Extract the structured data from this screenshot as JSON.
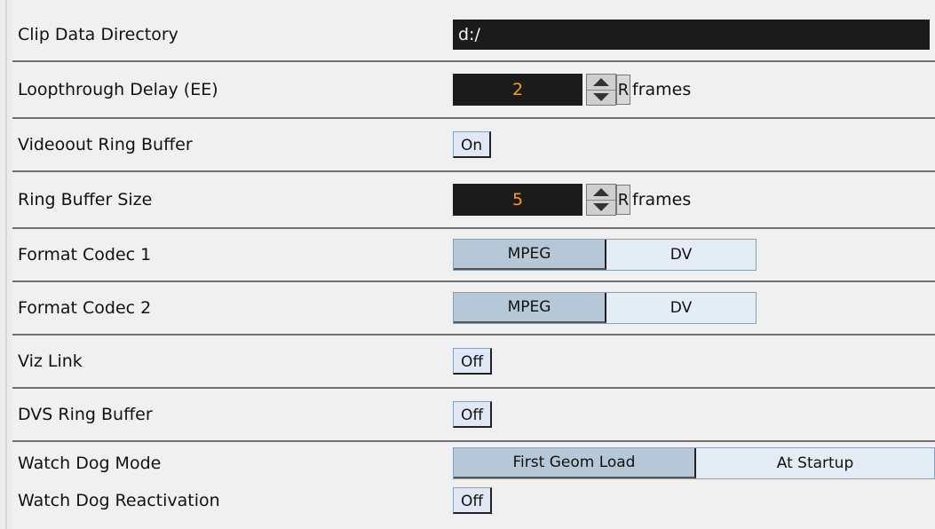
{
  "settings": {
    "clip_data_directory": {
      "label": "Clip Data Directory",
      "value": "d:/"
    },
    "loopthrough_delay": {
      "label": "Loopthrough Delay (EE)",
      "value": "2",
      "reset": "R",
      "unit": "frames"
    },
    "videoout_ring_buffer": {
      "label": "Videoout Ring Buffer",
      "value": "On"
    },
    "ring_buffer_size": {
      "label": "Ring Buffer Size",
      "value": "5",
      "reset": "R",
      "unit": "frames"
    },
    "format_codec_1": {
      "label": "Format Codec 1",
      "options": [
        "MPEG",
        "DV"
      ],
      "selected": "MPEG"
    },
    "format_codec_2": {
      "label": "Format Codec 2",
      "options": [
        "MPEG",
        "DV"
      ],
      "selected": "MPEG"
    },
    "viz_link": {
      "label": "Viz Link",
      "value": "Off"
    },
    "dvs_ring_buffer": {
      "label": "DVS Ring Buffer",
      "value": "Off"
    },
    "watch_dog_mode": {
      "label": "Watch Dog Mode",
      "options": [
        "First Geom Load",
        "At Startup"
      ],
      "selected": "First Geom Load"
    },
    "watch_dog_reactivation": {
      "label": "Watch Dog Reactivation",
      "value": "Off"
    }
  }
}
